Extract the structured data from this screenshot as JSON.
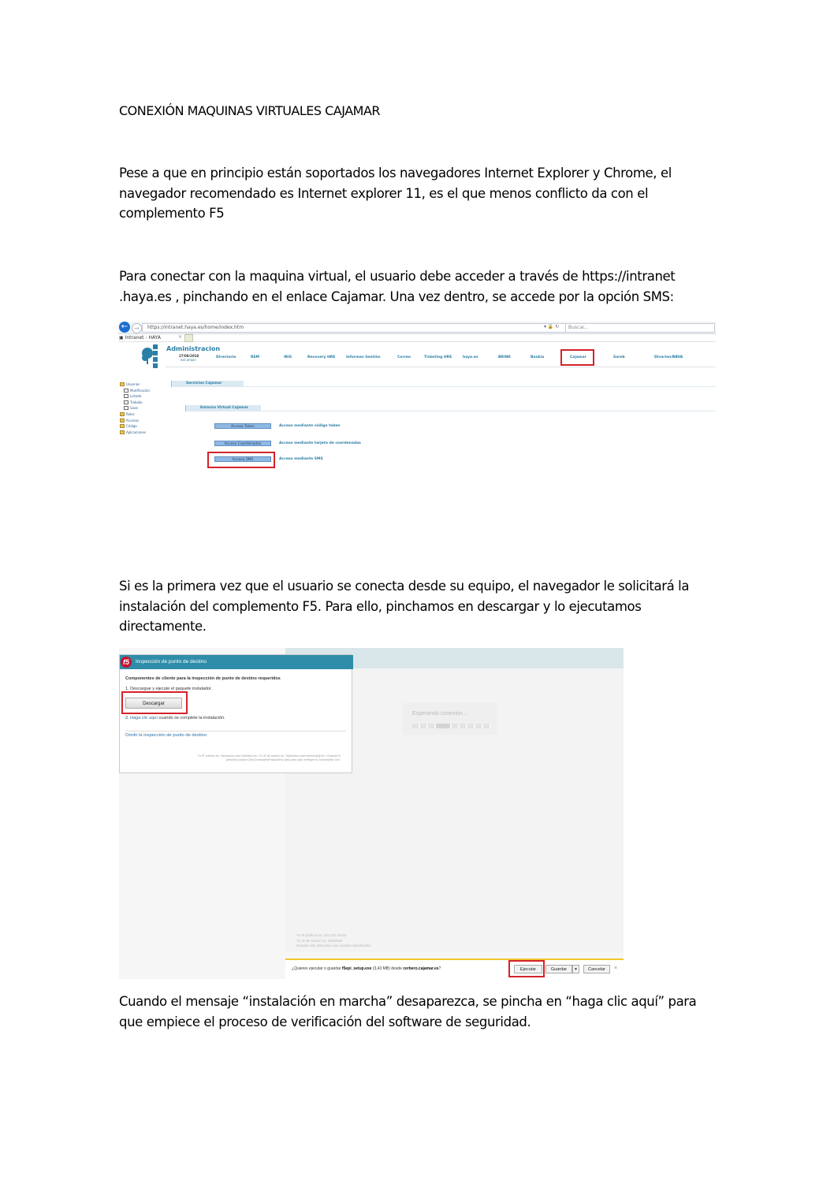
{
  "document": {
    "title": "CONEXIÓN MAQUINAS VIRTUALES CAJAMAR",
    "paragraph1": "Pese a que en principio están soportados los navegadores Internet Explorer y Chrome, el navegador recomendado es Internet explorer 11, es el que menos conflicto da con el complemento F5",
    "paragraph2": "Para conectar con la maquina virtual, el usuario debe acceder a través de https://intranet .haya.es , pinchando en el enlace Cajamar. Una vez dentro, se accede por la opción SMS:",
    "paragraph3": "Si es la primera vez que el usuario se conecta desde su equipo, el navegador le solicitará la instalación del complemento F5. Para ello, pinchamos en descargar y lo ejecutamos directamente.",
    "paragraph4": "Cuando el mensaje “instalación en marcha” desaparezca, se pincha en “haga clic aquí” para que empiece el proceso de verificación del software de seguridad."
  },
  "intranet": {
    "url": "https://intranet.haya.es/home/index.htm",
    "search_placeholder": "Buscar...",
    "tab_label": "Intranet - HAYA",
    "app_title": "Administracion",
    "date": "27/08/2018",
    "user": "ext.amjas",
    "menu": [
      "Directorio",
      "REM",
      "IRIS",
      "Recovery HRE",
      "Informes Gestión",
      "Correo",
      "Ticketing HRE",
      "haya.es",
      "BRINK",
      "Bankia",
      "Cajamar",
      "Sareb",
      "Divarian/BBVA"
    ],
    "tree": {
      "root": "Usuarios",
      "subs": [
        "Modificación",
        "Listado",
        "Traballo",
        "Gazo"
      ],
      "folders": [
        "Roles",
        "Accesos",
        "Código",
        "Aplicaciones"
      ]
    },
    "section1": "Servicios Cajamar",
    "section2": "Entorno Virtual Cajamar",
    "access": [
      {
        "button": "Acceso Token",
        "desc": "Acceso mediante código token"
      },
      {
        "button": "Acceso Coordenadas",
        "desc": "Acceso mediante tarjeta de coordenadas"
      },
      {
        "button": "Acceso SMS",
        "desc": "Acceso mediante SMS"
      }
    ]
  },
  "f5": {
    "header": "Inspección de punto de destino",
    "components": "Componentes de cliente para la inspección de punto de destino requeridos",
    "step1": "1. Descargue y ejecute el paquete instalador.",
    "download_button": "Descargar",
    "step2_prefix": "2.",
    "step2_link": "Haga clic aquí",
    "step2_suffix": "cuando se complete la instalación.",
    "omit_link": "Omitir la inspección de punto de destino",
    "note": "Tu IP pública es: %{session.user.clientip}<br> Tu ID de sesión es: %{session.user.sessionid}<br> Guarda % {session.custom.DarContraseñaPasswd%} dato para que verifique tu contraseña.<br>",
    "waiting": "Esperando conexión...",
    "footer": [
      "Tu IP pública es: 194.224.19.82",
      "Tu ID de sesión es: 2f8d2564",
      "Guarda este dato para que puedas identificarte"
    ],
    "download_prompt_prefix": "¿Quieres ejecutar o guardar ",
    "download_file": "f5epi_setup.exe",
    "download_size": " (3,43 MB) desde ",
    "download_host": "cerbero.cajamar.es",
    "download_prompt_suffix": "?",
    "run_button": "Ejecutar",
    "save_button": "Guardar",
    "cancel_button": "Cancelar"
  }
}
